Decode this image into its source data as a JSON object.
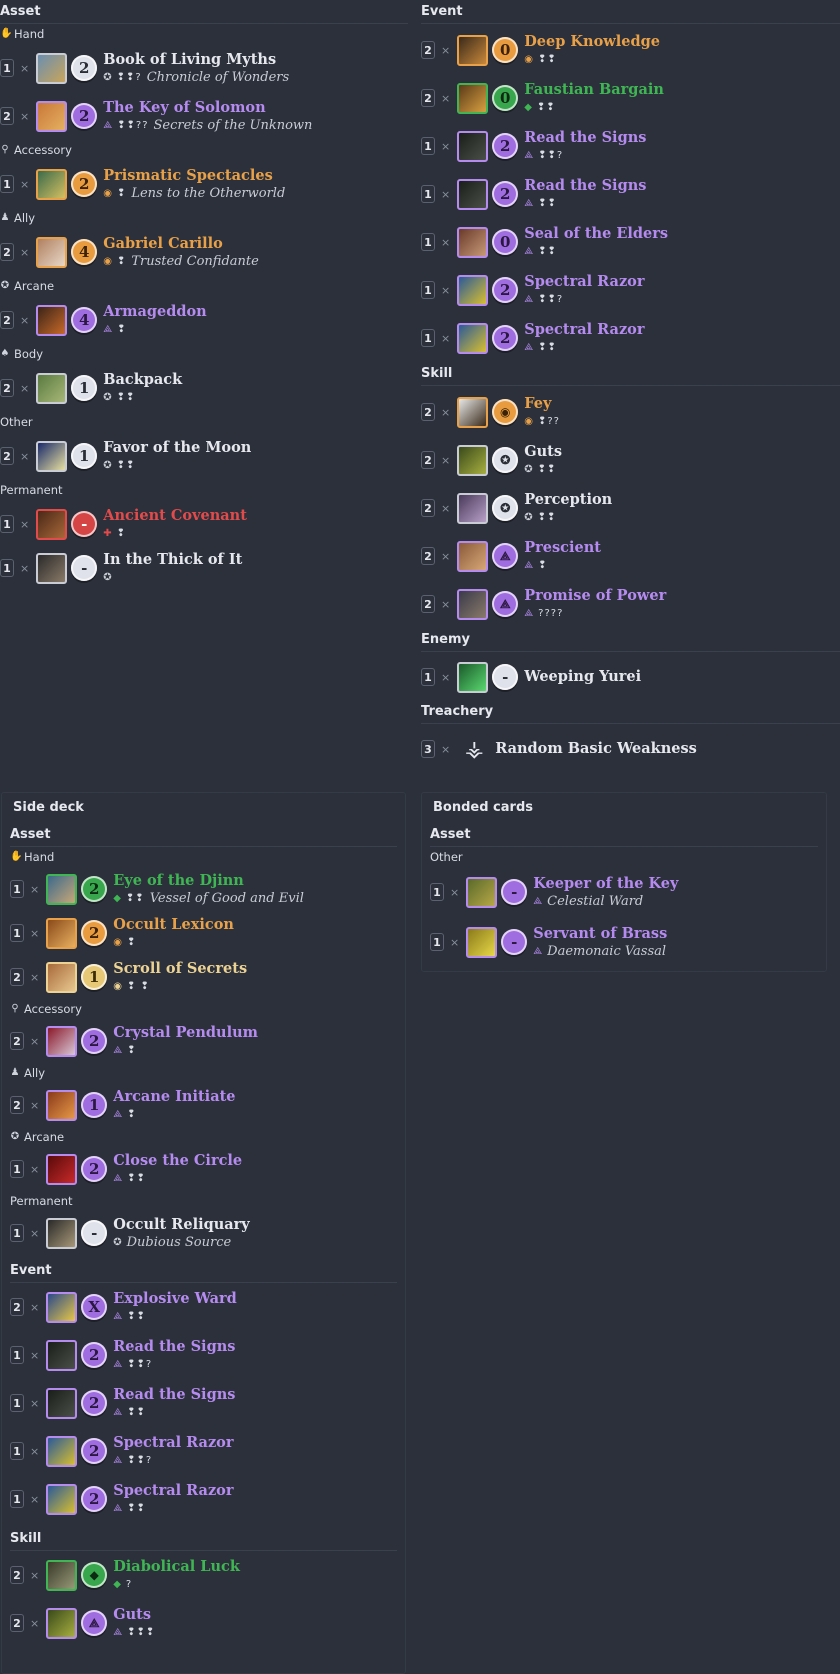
{
  "colors": {
    "background": "#2b303b",
    "mystic": "#b68bf0",
    "seeker": "#e8a149",
    "rogue": "#3fb653",
    "neutral": "#e6e8ee",
    "basic_weakness": "#e24b4b"
  },
  "main_deck": {
    "left": {
      "section": "Asset",
      "groups": [
        {
          "label": "Hand",
          "icon": "hand-icon",
          "glyph": "✋",
          "cards": [
            {
              "qty": "1",
              "name": "Book of Living Myths",
              "cost": "2",
              "faction": "neutral",
              "faction_icon": "neutral-class-icon",
              "icons": "❢❢?",
              "subname": "Chronicle of Wonders",
              "thumb": [
                "#6a8fb0",
                "#c9a55a"
              ]
            },
            {
              "qty": "2",
              "name": "The Key of Solomon",
              "cost": "2",
              "faction": "mystic",
              "faction_icon": "mystic-class-icon",
              "icons": "❢❢??",
              "subname": "Secrets of the Unknown",
              "thumb": [
                "#c9783a",
                "#e5b060"
              ]
            }
          ]
        },
        {
          "label": "Accessory",
          "icon": "accessory-icon",
          "glyph": "⚲",
          "cards": [
            {
              "qty": "1",
              "name": "Prismatic Spectacles",
              "cost": "2",
              "faction": "seeker",
              "faction_icon": "seeker-class-icon",
              "icons": "❢",
              "subname": "Lens to the Otherworld",
              "thumb": [
                "#3a6b4a",
                "#d4c060"
              ]
            }
          ]
        },
        {
          "label": "Ally",
          "icon": "ally-icon",
          "glyph": "♟",
          "cards": [
            {
              "qty": "2",
              "name": "Gabriel Carillo",
              "cost": "4",
              "faction": "seeker",
              "faction_icon": "seeker-class-icon",
              "icons": "❢",
              "subname": "Trusted Confidante",
              "thumb": [
                "#b08060",
                "#e8d8c8"
              ]
            }
          ]
        },
        {
          "label": "Arcane",
          "icon": "arcane-icon",
          "glyph": "✪",
          "cards": [
            {
              "qty": "2",
              "name": "Armageddon",
              "cost": "4",
              "faction": "mystic",
              "faction_icon": "mystic-class-icon",
              "icons": "❢",
              "subname": "",
              "thumb": [
                "#3a2418",
                "#c86a28"
              ]
            }
          ]
        },
        {
          "label": "Body",
          "icon": "body-icon",
          "glyph": "♠",
          "cards": [
            {
              "qty": "2",
              "name": "Backpack",
              "cost": "1",
              "faction": "neutral",
              "faction_icon": "neutral-class-icon",
              "icons": "❢❢",
              "subname": "",
              "thumb": [
                "#5a7a40",
                "#a8b878"
              ]
            }
          ]
        },
        {
          "label": "Other",
          "icon": "",
          "glyph": "",
          "cards": [
            {
              "qty": "2",
              "name": "Favor of the Moon",
              "cost": "1",
              "faction": "neutral",
              "faction_icon": "neutral-class-icon",
              "icons": "❢❢",
              "subname": "",
              "thumb": [
                "#1a2a6a",
                "#e8e0a0"
              ]
            }
          ]
        },
        {
          "label": "Permanent",
          "icon": "",
          "glyph": "",
          "cards": [
            {
              "qty": "1",
              "name": "Ancient Covenant",
              "cost": "-",
              "faction": "weak",
              "faction_icon": "basic-weakness-icon",
              "icons": "❢",
              "subname": "",
              "thumb": [
                "#4a2818",
                "#a86838"
              ]
            },
            {
              "qty": "1",
              "name": "In the Thick of It",
              "cost": "-",
              "faction": "neutral",
              "faction_icon": "neutral-class-icon",
              "icons": "",
              "subname": "",
              "thumb": [
                "#2a2a2a",
                "#8a7a68"
              ]
            }
          ]
        }
      ]
    },
    "right": [
      {
        "section": "Event",
        "cards": [
          {
            "qty": "2",
            "name": "Deep Knowledge",
            "cost": "0",
            "faction": "seeker",
            "faction_icon": "seeker-class-icon",
            "icons": "❢❢",
            "thumb": [
              "#3a2a1a",
              "#c8883a"
            ]
          },
          {
            "qty": "2",
            "name": "Faustian Bargain",
            "cost": "0",
            "faction": "rogue",
            "faction_icon": "rogue-class-icon",
            "icons": "❢❢",
            "thumb": [
              "#5a3a18",
              "#d8a040"
            ]
          },
          {
            "qty": "1",
            "name": "Read the Signs",
            "cost": "2",
            "faction": "mystic",
            "faction_icon": "mystic-class-icon",
            "icons": "❢❢?",
            "thumb": [
              "#1a1e1a",
              "#4a5048"
            ]
          },
          {
            "qty": "1",
            "name": "Read the Signs",
            "cost": "2",
            "faction": "mystic",
            "faction_icon": "mystic-class-icon",
            "icons": "❢❢",
            "thumb": [
              "#1a1e1a",
              "#4a5048"
            ]
          },
          {
            "qty": "1",
            "name": "Seal of the Elders",
            "cost": "0",
            "faction": "mystic",
            "faction_icon": "mystic-class-icon",
            "icons": "❢❢",
            "thumb": [
              "#6a3a2a",
              "#c89a78"
            ]
          },
          {
            "qty": "1",
            "name": "Spectral Razor",
            "cost": "2",
            "faction": "mystic",
            "faction_icon": "mystic-class-icon",
            "icons": "❢❢?",
            "thumb": [
              "#2a5a9a",
              "#d8c030"
            ]
          },
          {
            "qty": "1",
            "name": "Spectral Razor",
            "cost": "2",
            "faction": "mystic",
            "faction_icon": "mystic-class-icon",
            "icons": "❢❢",
            "thumb": [
              "#2a5a9a",
              "#d8c030"
            ]
          }
        ]
      },
      {
        "section": "Skill",
        "cards": [
          {
            "qty": "2",
            "name": "Fey",
            "cost": "",
            "faction": "seeker",
            "faction_icon": "seeker-class-icon",
            "icons": "❢??",
            "thumb": [
              "#e8e8e8",
              "#3a2a1a"
            ]
          },
          {
            "qty": "2",
            "name": "Guts",
            "cost": "",
            "faction": "neutral",
            "faction_icon": "neutral-class-icon",
            "icons": "❢❢",
            "thumb": [
              "#3a4a1a",
              "#a8b040"
            ]
          },
          {
            "qty": "2",
            "name": "Perception",
            "cost": "",
            "faction": "neutral",
            "faction_icon": "neutral-class-icon",
            "icons": "❢❢",
            "thumb": [
              "#4a3a5a",
              "#b8a0c8"
            ]
          },
          {
            "qty": "2",
            "name": "Prescient",
            "cost": "",
            "faction": "mystic",
            "faction_icon": "mystic-class-icon",
            "icons": "❢",
            "thumb": [
              "#8a5a3a",
              "#d8a878"
            ]
          },
          {
            "qty": "2",
            "name": "Promise of Power",
            "cost": "",
            "faction": "mystic",
            "faction_icon": "mystic-class-icon",
            "icons": "????",
            "thumb": [
              "#3a3a4a",
              "#8a7a6a"
            ]
          }
        ]
      },
      {
        "section": "Enemy",
        "cards": [
          {
            "qty": "1",
            "name": "Weeping Yurei",
            "cost": "-",
            "faction": "neutral",
            "faction_icon": "",
            "icons": "",
            "thumb": [
              "#1a5a2a",
              "#5ad870"
            ]
          }
        ]
      },
      {
        "section": "Treachery",
        "cards": [
          {
            "qty": "3",
            "name": "Random Basic Weakness",
            "cost": "",
            "faction": "neutral",
            "faction_icon": "",
            "icons": "",
            "thumb": [
              "",
              ""
            ],
            "weakness_icon": true
          }
        ]
      }
    ]
  },
  "side_deck": {
    "title": "Side deck",
    "asset_label": "Asset",
    "groups": [
      {
        "label": "Hand",
        "icon": "hand-icon",
        "glyph": "✋",
        "cards": [
          {
            "qty": "1",
            "name": "Eye of the Djinn",
            "cost": "2",
            "faction": "rogue",
            "faction_icon": "rogue-class-icon",
            "icons": "❢❢",
            "subname": "Vessel of Good and Evil",
            "thumb": [
              "#3a6a8a",
              "#c8a878"
            ]
          },
          {
            "qty": "1",
            "name": "Occult Lexicon",
            "cost": "2",
            "faction": "seeker",
            "faction_icon": "seeker-class-icon",
            "icons": "❢",
            "subname": "",
            "thumb": [
              "#8a4a1a",
              "#e8b060"
            ]
          },
          {
            "qty": "2",
            "name": "Scroll of Secrets",
            "cost": "1",
            "faction": "basic",
            "faction_icon": "seeker-class-icon",
            "icons": "❢ ❢",
            "subname": "",
            "thumb": [
              "#a86a3a",
              "#e8c890"
            ]
          }
        ]
      },
      {
        "label": "Accessory",
        "icon": "accessory-icon",
        "glyph": "⚲",
        "cards": [
          {
            "qty": "2",
            "name": "Crystal Pendulum",
            "cost": "2",
            "faction": "mystic",
            "faction_icon": "mystic-class-icon",
            "icons": "❢",
            "subname": "",
            "thumb": [
              "#8a1a2a",
              "#d8c8d8"
            ]
          }
        ]
      },
      {
        "label": "Ally",
        "icon": "ally-icon",
        "glyph": "♟",
        "cards": [
          {
            "qty": "2",
            "name": "Arcane Initiate",
            "cost": "1",
            "faction": "mystic",
            "faction_icon": "mystic-class-icon",
            "icons": "❢",
            "subname": "",
            "thumb": [
              "#8a3a1a",
              "#e89a48"
            ]
          }
        ]
      },
      {
        "label": "Arcane",
        "icon": "arcane-icon",
        "glyph": "✪",
        "cards": [
          {
            "qty": "1",
            "name": "Close the Circle",
            "cost": "2",
            "faction": "mystic",
            "faction_icon": "mystic-class-icon",
            "icons": "❢❢",
            "subname": "",
            "thumb": [
              "#5a0a0a",
              "#c82a2a"
            ]
          }
        ]
      },
      {
        "label": "Permanent",
        "icon": "",
        "glyph": "",
        "cards": [
          {
            "qty": "1",
            "name": "Occult Reliquary",
            "cost": "-",
            "faction": "neutral",
            "faction_icon": "neutral-class-icon",
            "icons": "",
            "subname": "Dubious Source",
            "thumb": [
              "#2a2a2a",
              "#a89878"
            ]
          }
        ]
      }
    ],
    "sections": [
      {
        "section": "Event",
        "cards": [
          {
            "qty": "2",
            "name": "Explosive Ward",
            "cost": "X",
            "faction": "mystic",
            "faction_icon": "mystic-class-icon",
            "icons": "❢❢",
            "thumb": [
              "#2a4a8a",
              "#e8c848"
            ]
          },
          {
            "qty": "1",
            "name": "Read the Signs",
            "cost": "2",
            "faction": "mystic",
            "faction_icon": "mystic-class-icon",
            "icons": "❢❢?",
            "thumb": [
              "#1a1e1a",
              "#4a5048"
            ]
          },
          {
            "qty": "1",
            "name": "Read the Signs",
            "cost": "2",
            "faction": "mystic",
            "faction_icon": "mystic-class-icon",
            "icons": "❢❢",
            "thumb": [
              "#1a1e1a",
              "#4a5048"
            ]
          },
          {
            "qty": "1",
            "name": "Spectral Razor",
            "cost": "2",
            "faction": "mystic",
            "faction_icon": "mystic-class-icon",
            "icons": "❢❢?",
            "thumb": [
              "#2a5a9a",
              "#d8c030"
            ]
          },
          {
            "qty": "1",
            "name": "Spectral Razor",
            "cost": "2",
            "faction": "mystic",
            "faction_icon": "mystic-class-icon",
            "icons": "❢❢",
            "thumb": [
              "#2a5a9a",
              "#d8c030"
            ]
          }
        ]
      },
      {
        "section": "Skill",
        "cards": [
          {
            "qty": "2",
            "name": "Diabolical Luck",
            "cost": "",
            "faction": "rogue",
            "faction_icon": "rogue-class-icon",
            "icons": "?",
            "thumb": [
              "#3a3a2a",
              "#989a78"
            ]
          },
          {
            "qty": "2",
            "name": "Guts",
            "cost": "",
            "faction": "mystic",
            "faction_icon": "mystic-class-icon",
            "icons": "❢❢❢",
            "thumb": [
              "#3a4a1a",
              "#a8b040"
            ]
          }
        ]
      }
    ]
  },
  "bonded": {
    "title": "Bonded cards",
    "asset_label": "Asset",
    "group_label": "Other",
    "cards": [
      {
        "qty": "1",
        "name": "Keeper of the Key",
        "cost": "-",
        "faction": "mystic",
        "faction_icon": "mystic-class-icon",
        "icons": "",
        "subname": "Celestial Ward",
        "thumb": [
          "#5a6a2a",
          "#b8a848"
        ]
      },
      {
        "qty": "1",
        "name": "Servant of Brass",
        "cost": "-",
        "faction": "mystic",
        "faction_icon": "mystic-class-icon",
        "icons": "",
        "subname": "Daemonaic Vassal",
        "thumb": [
          "#8a7a1a",
          "#e8d848"
        ]
      }
    ]
  },
  "ui": {
    "times": "×"
  }
}
